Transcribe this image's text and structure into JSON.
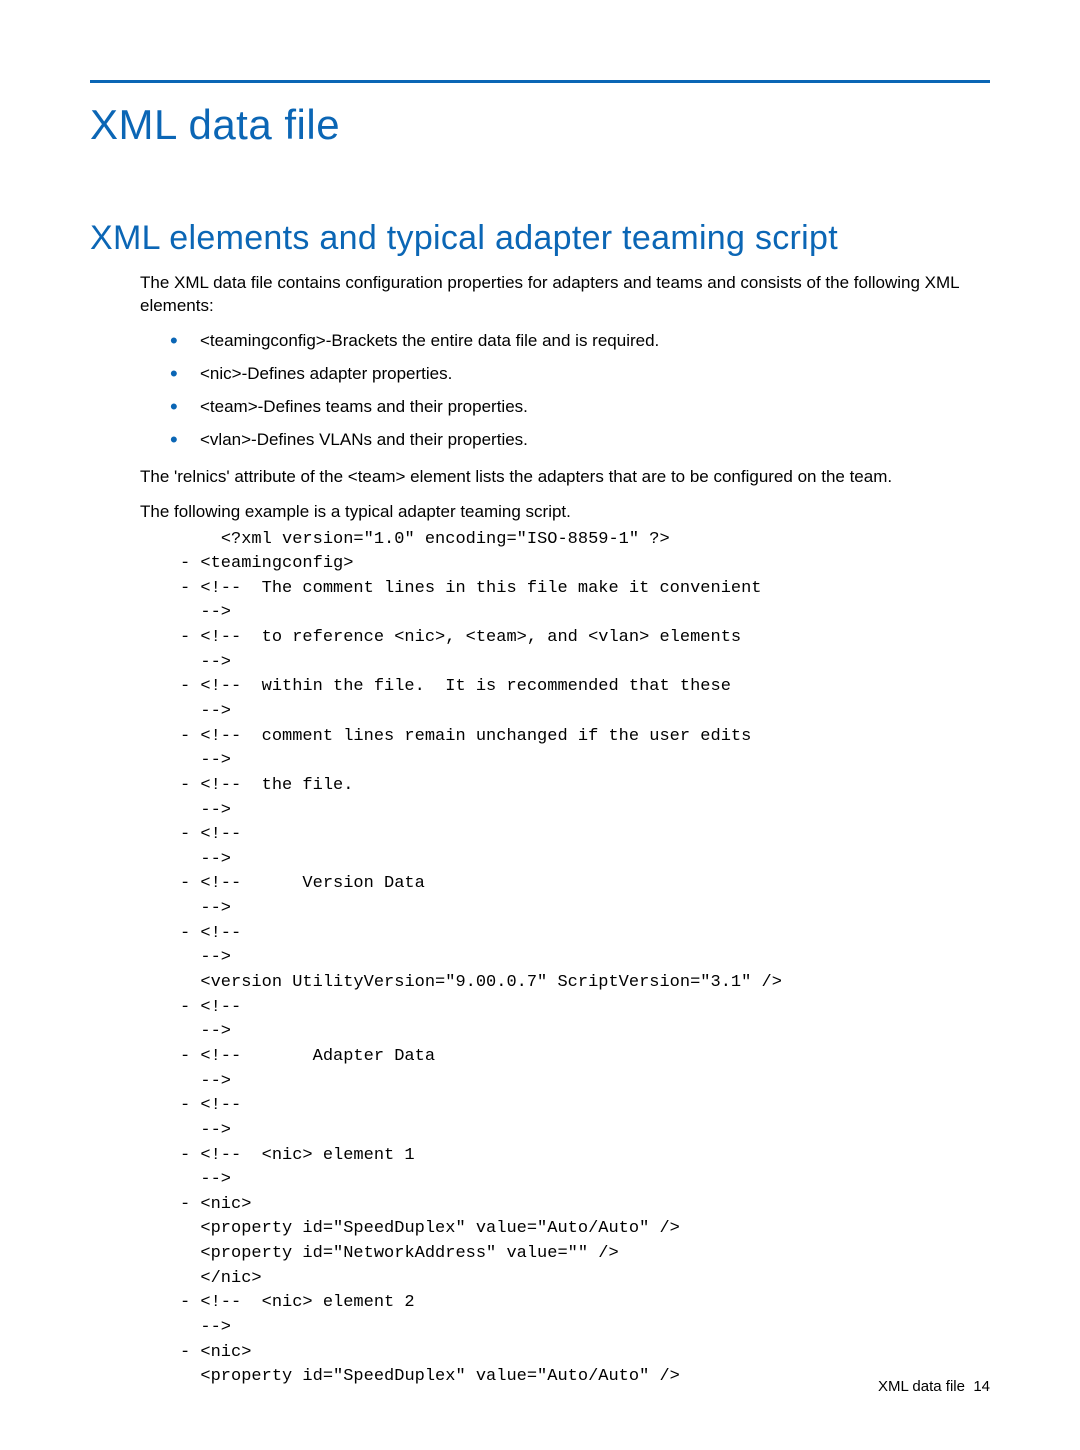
{
  "colors": {
    "accent": "#0b66b5"
  },
  "header": {
    "title": "XML data file"
  },
  "section": {
    "title": "XML elements and typical adapter teaming script"
  },
  "intro": "The XML data file contains configuration properties for adapters and teams and consists of the following XML elements:",
  "bullets": {
    "b0": "<teamingconfig>-Brackets the entire data file and is required.",
    "b1": "<nic>-Defines adapter properties.",
    "b2": "<team>-Defines teams and their properties.",
    "b3": "<vlan>-Defines VLANs and their properties."
  },
  "para2": "The 'relnics' attribute of the <team> element lists the adapters that are to be configured on the team.",
  "para3": "The following example is a typical adapter teaming script.",
  "code": "    <?xml version=\"1.0\" encoding=\"ISO-8859-1\" ?>\n- <teamingconfig>\n- <!--  The comment lines in this file make it convenient \n  -->\n- <!--  to reference <nic>, <team>, and <vlan> elements  \n  -->\n- <!--  within the file.  It is recommended that these  \n  -->\n- <!--  comment lines remain unchanged if the user edits  \n  -->\n- <!--  the file.                                         \n  -->\n- <!--                                                    \n  -->\n- <!--      Version Data                                  \n  -->\n- <!--                                                    \n  -->\n  <version UtilityVersion=\"9.00.0.7\" ScriptVersion=\"3.1\" />\n- <!--                                                    \n  -->\n- <!--       Adapter Data                                 \n  -->\n- <!--                                                    \n  -->\n- <!--  <nic> element 1                                   \n  -->\n- <nic>\n  <property id=\"SpeedDuplex\" value=\"Auto/Auto\" />\n  <property id=\"NetworkAddress\" value=\"\" />\n  </nic>\n- <!--  <nic> element 2                                   \n  -->\n- <nic>\n  <property id=\"SpeedDuplex\" value=\"Auto/Auto\" />",
  "footer": {
    "label": "XML data file",
    "page": "14"
  }
}
